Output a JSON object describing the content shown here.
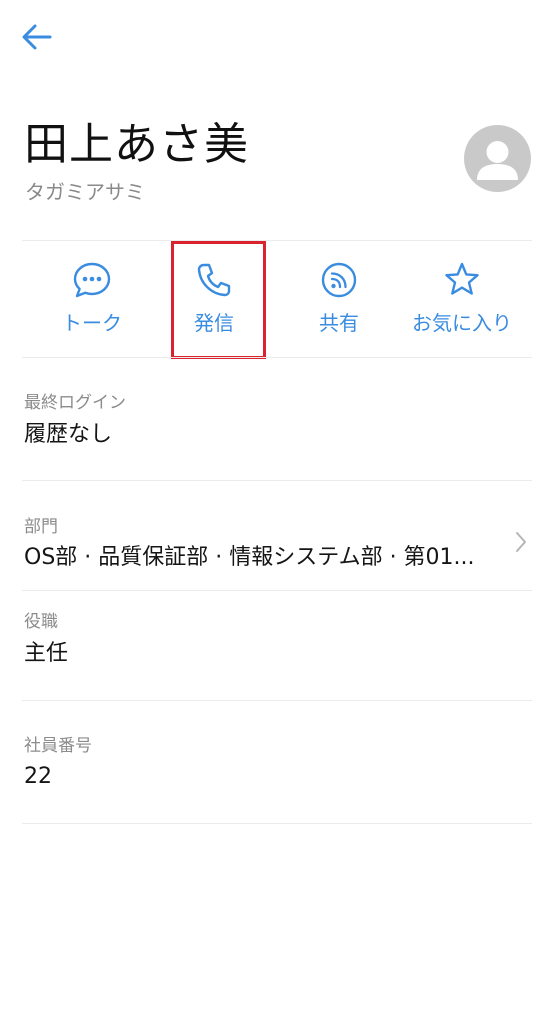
{
  "header": {
    "back_icon": "arrow-left-icon"
  },
  "profile": {
    "name": "田上あさ美",
    "kana": "タガミアサミ",
    "avatar_icon": "person-icon"
  },
  "actions": [
    {
      "label": "トーク",
      "icon": "chat-bubble-icon"
    },
    {
      "label": "発信",
      "icon": "phone-icon"
    },
    {
      "label": "共有",
      "icon": "share-feed-icon"
    },
    {
      "label": "お気に入り",
      "icon": "star-icon"
    }
  ],
  "fields": {
    "last_login": {
      "label": "最終ログイン",
      "value": "履歴なし"
    },
    "department": {
      "label": "部門",
      "value": "OS部 · 品質保証部 · 情報システム部 · 第01..."
    },
    "position": {
      "label": "役職",
      "value": "主任"
    },
    "employee_no": {
      "label": "社員番号",
      "value": "22"
    }
  },
  "colors": {
    "accent": "#3a8ce0",
    "highlight_border": "#d9232e",
    "avatar_bg": "#c9c9c9",
    "divider": "#ebebeb",
    "secondary_text": "#8c8c8c"
  }
}
